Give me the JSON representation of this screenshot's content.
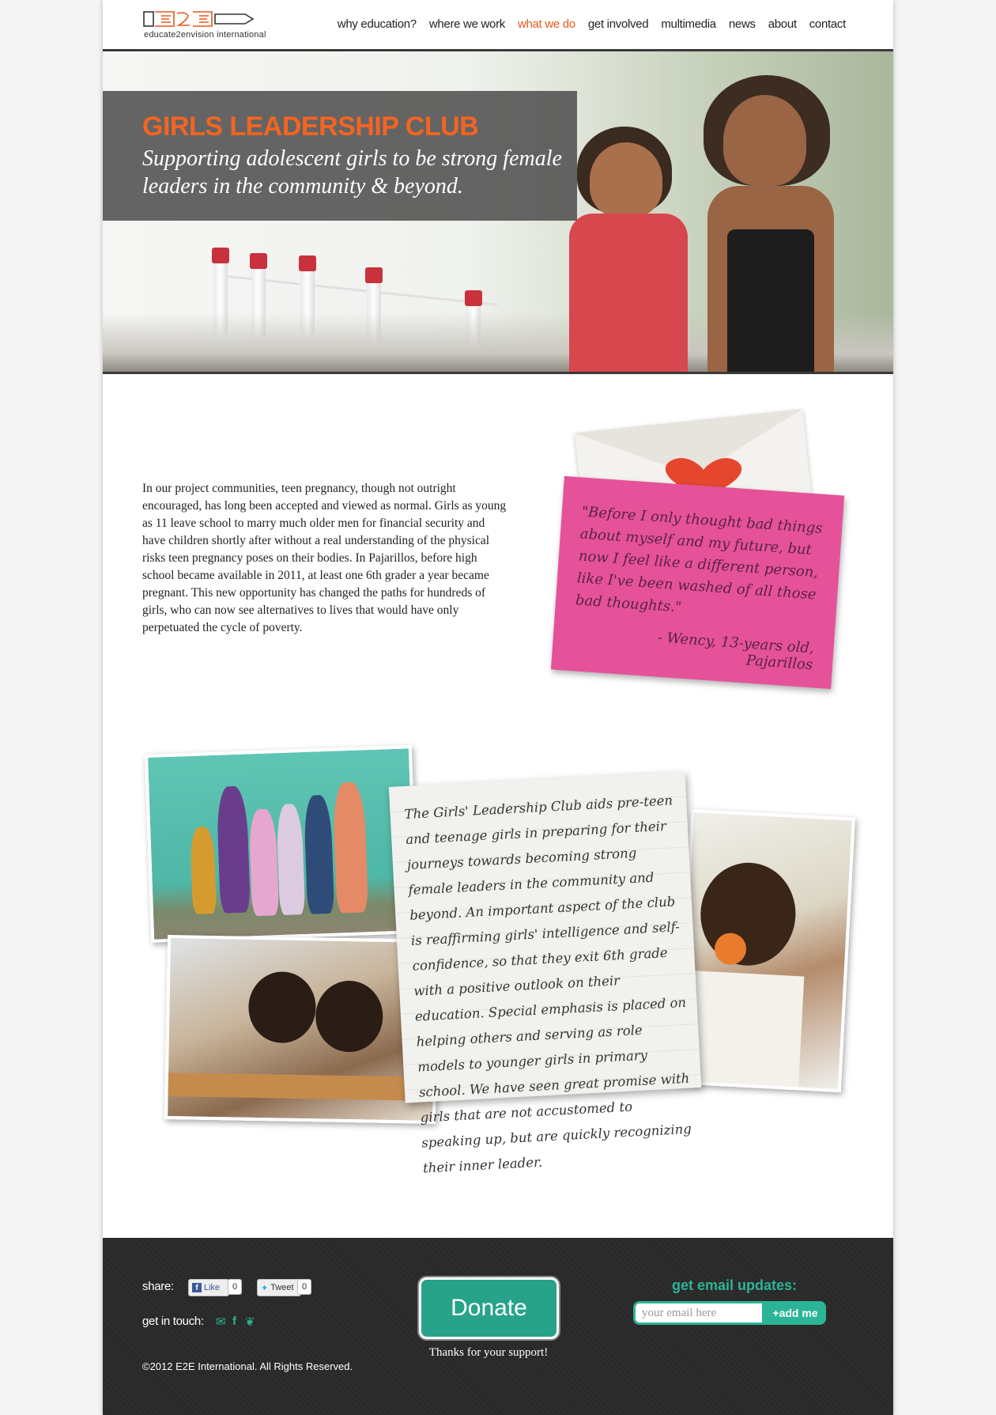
{
  "header": {
    "logo_mark": "E2E",
    "logo_tagline": "educate2envision international",
    "nav": [
      {
        "label": "why education?"
      },
      {
        "label": "where we work"
      },
      {
        "label": "what we do",
        "active": true
      },
      {
        "label": "get involved"
      },
      {
        "label": "multimedia"
      },
      {
        "label": "news"
      },
      {
        "label": "about"
      },
      {
        "label": "contact"
      }
    ]
  },
  "hero": {
    "title": "GIRLS LEADERSHIP CLUB",
    "subtitle": "Supporting adolescent girls to be strong female leaders in the community & beyond."
  },
  "intro": {
    "text": "In our project communities, teen pregnancy, though not outright encouraged, has long been accepted and viewed as normal. Girls as young as 11 leave school to marry much older men for financial security and have children shortly after without a real understanding of the physical risks teen pregnancy poses on their bodies. In Pajarillos, before high school became available in 2011, at least one 6th grader a year became pregnant. This new opportunity has changed the paths for hundreds of girls, who can now see alternatives to lives that would have only perpetuated the cycle of poverty."
  },
  "quote": {
    "text": "\"Before I only thought bad things about myself and my future, but now I feel like a different person, like I've been washed of all those bad thoughts.\"",
    "attribution": "- Wency, 13-years old, Pajarillos"
  },
  "note": {
    "text": "The Girls' Leadership Club aids pre-teen and teenage girls in preparing for their journeys towards becoming strong female leaders in the community and beyond. An important aspect of the club is reaffirming girls' intelligence and self-confidence, so that they exit 6th grade with a positive outlook on their education. Special emphasis is placed on helping others and serving as role models to younger girls in primary school. We have seen great promise with girls that are not accustomed to speaking up, but are quickly recognizing their inner leader."
  },
  "footer": {
    "share_label": "share:",
    "like_label": "Like",
    "like_count": "0",
    "tweet_label": "Tweet",
    "tweet_count": "0",
    "touch_label": "get in touch:",
    "copyright": "©2012 E2E International. All Rights Reserved.",
    "donate_label": "Donate",
    "thanks": "Thanks for your support!",
    "email_heading": "get email updates:",
    "email_placeholder": "your email here",
    "add_label": "+add me"
  },
  "colors": {
    "accent_orange": "#e8561b",
    "teal": "#2bb596",
    "pink_card": "#e5529a",
    "footer_bg": "#2b2b2b"
  }
}
